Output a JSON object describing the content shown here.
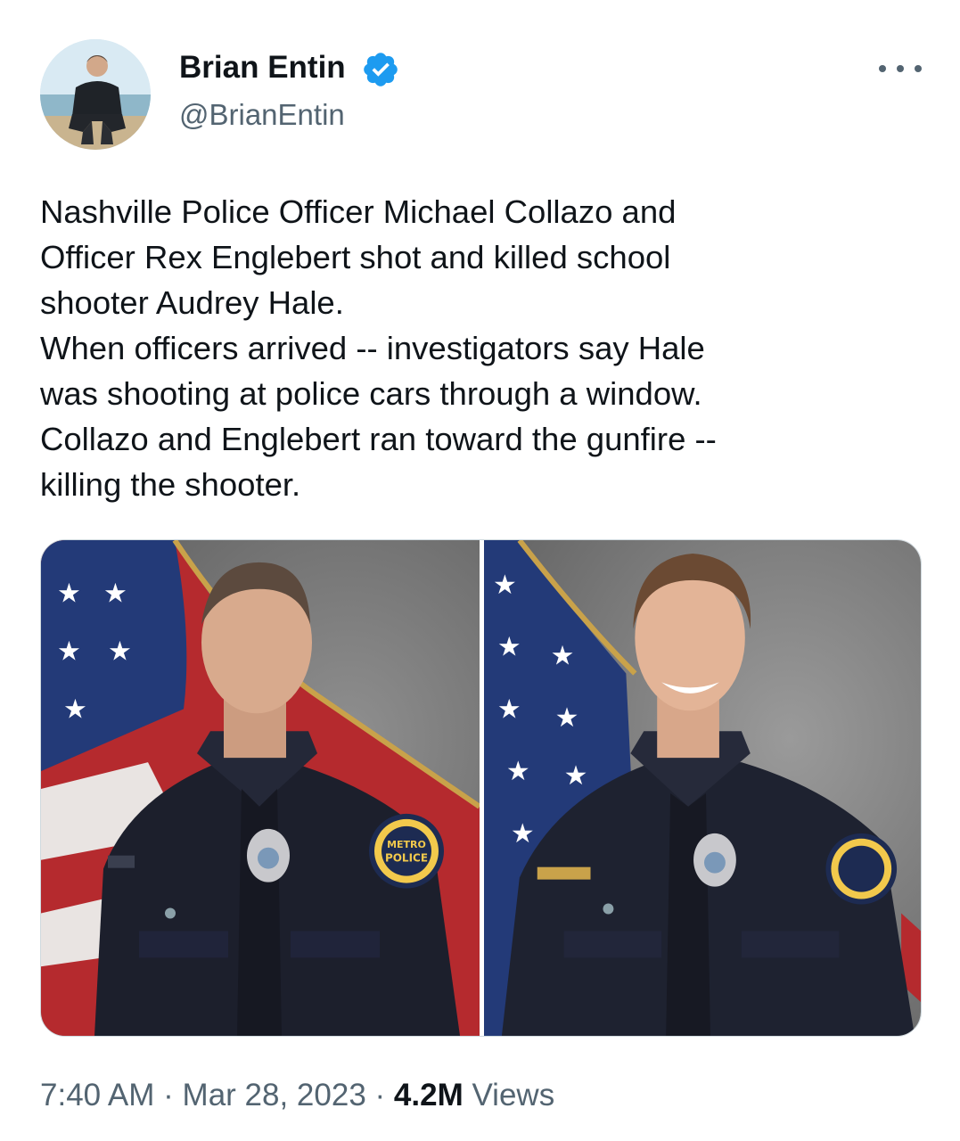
{
  "author": {
    "name": "Brian Entin",
    "handle": "@BrianEntin",
    "verified": true,
    "avatar_icon": "profile-photo"
  },
  "tweet": {
    "lines": [
      "Nashville Police Officer Michael Collazo and",
      "Officer Rex Englebert shot and killed school",
      "shooter Audrey Hale.",
      "When officers arrived -- investigators say Hale",
      "was shooting at police cars through a window.",
      "Collazo and Englebert ran toward the gunfire --",
      "killing the shooter."
    ]
  },
  "media": {
    "photos": [
      {
        "icon": "officer-portrait-photo"
      },
      {
        "icon": "officer-portrait-photo"
      }
    ],
    "badge_text": [
      "METRO",
      "POLICE"
    ]
  },
  "meta": {
    "time": "7:40 AM",
    "separator": "·",
    "date": "Mar 28, 2023",
    "views_count": "4.2M",
    "views_label": "Views"
  },
  "colors": {
    "verified": "#1d9bf0",
    "text_primary": "#0f1419",
    "text_secondary": "#536471",
    "border": "#cfd9de"
  }
}
